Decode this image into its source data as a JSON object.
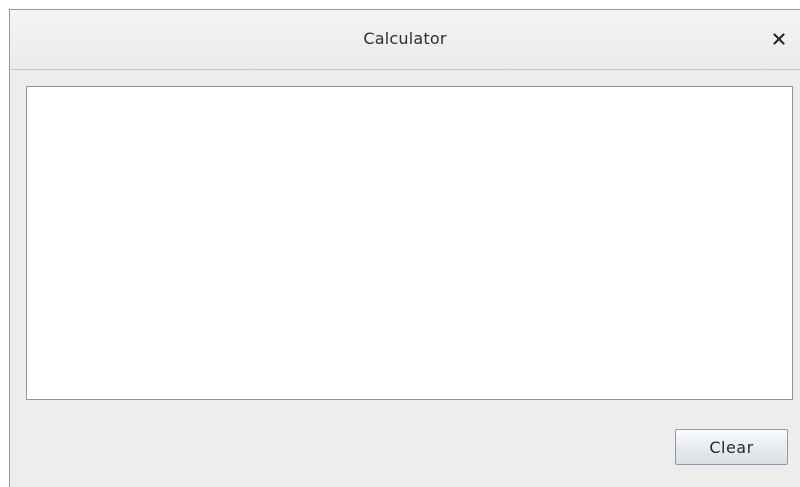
{
  "window": {
    "title": "Calculator",
    "close_icon": "close-icon"
  },
  "display": {
    "value": ""
  },
  "actions": {
    "clear_label": "Clear"
  },
  "colors": {
    "window_bg": "#ededed",
    "titlebar_bg": "#f0f0f0",
    "display_border": "#8c98a6",
    "button_border": "#8e9aa7"
  }
}
